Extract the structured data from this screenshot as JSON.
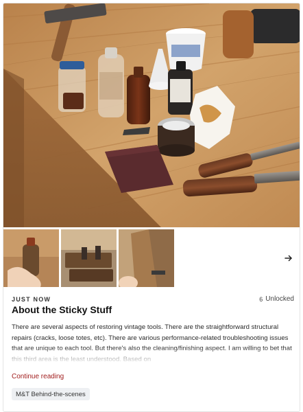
{
  "post": {
    "time": "JUST NOW",
    "unlocked_count": "6",
    "unlocked_label": "Unlocked",
    "title": "About the Sticky Stuff",
    "excerpt": "There are several aspects of restoring vintage tools. There are the straightforward structural repairs (cracks, loose totes, etc). There are various performance-related troubleshooting issues that are unique to each tool. But there's also the cleaning/finishing aspect. I am willing to bet that this third area is the least understood. Based on",
    "continue_label": "Continue reading",
    "tag": "M&T Behind-the-scenes"
  },
  "gallery": {
    "hero_alt": "Workbench with bottles, jars, a funnel, abrasive pad and chisels",
    "thumbnails": [
      "bottle in hand",
      "wooden planes",
      "plane being held"
    ],
    "next_icon": "arrow-right-icon"
  },
  "colors": {
    "accent_link": "#a11d1d",
    "tag_bg": "#eef0f3",
    "wood": "#c9975f"
  }
}
